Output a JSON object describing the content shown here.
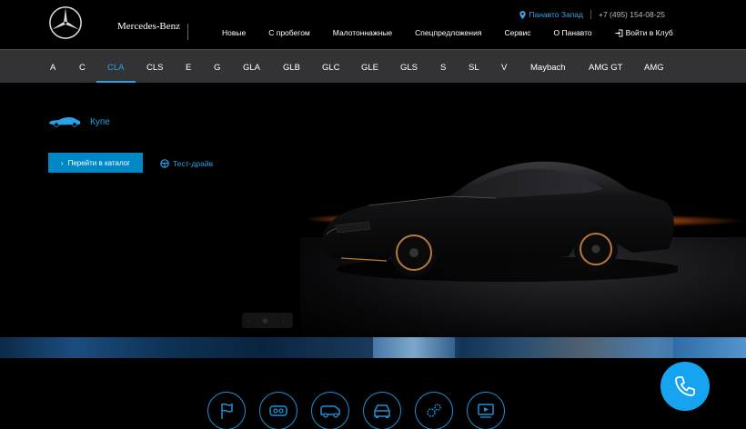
{
  "header": {
    "brand": "Mercedes-Benz",
    "location": "Панавто Запад",
    "phone": "+7 (495) 154-08-25",
    "nav": [
      "Новые",
      "С пробегом",
      "Малотоннажные",
      "Спецпредложения",
      "Сервис",
      "О Панавто"
    ],
    "login": "Войти в Клуб"
  },
  "models": {
    "items": [
      "A",
      "C",
      "CLA",
      "CLS",
      "E",
      "G",
      "GLA",
      "GLB",
      "GLC",
      "GLE",
      "GLS",
      "S",
      "SL",
      "V",
      "Maybach",
      "AMG GT",
      "AMG"
    ],
    "active": "CLA"
  },
  "hero": {
    "body_type": "Купе",
    "catalog_button": "Перейти в каталог",
    "test_drive": "Тест-драйв"
  },
  "colors": {
    "accent": "#2aa1e6",
    "button": "#0088c6",
    "model_bar": "#333336",
    "phone_button": "#16a3f0"
  },
  "bottom_icons": [
    "flag-icon",
    "vr-headset-icon",
    "van-icon",
    "car-front-icon",
    "gears-icon",
    "video-play-icon"
  ],
  "contact": {
    "icon": "phone-icon"
  }
}
